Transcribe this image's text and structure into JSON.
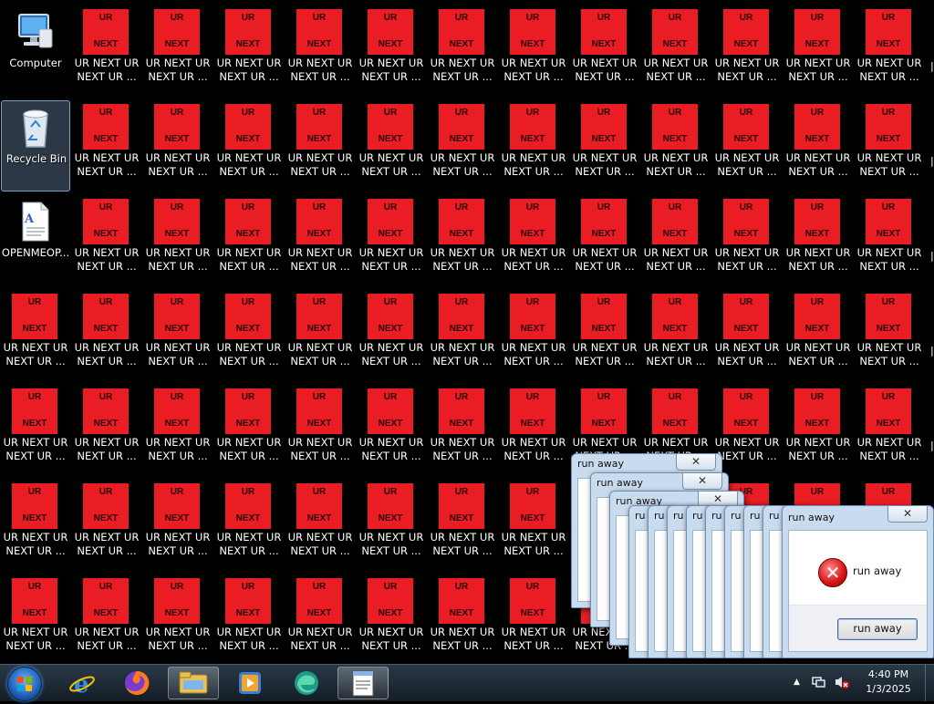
{
  "desktop": {
    "computer_label": "Computer",
    "recycle_label": "Recycle Bin",
    "doc_label": "OPENMEOP...",
    "ur_icon": {
      "top_text": "UR",
      "bottom_text": "NEXT",
      "line1": "UR NEXT UR",
      "line2": "NEXT UR ..."
    },
    "colors": {
      "ur_red": "#ea1c24"
    }
  },
  "dialog": {
    "title": "run away",
    "message": "run away",
    "button": "run away",
    "close_symbol": "✕",
    "cut_title": "ru"
  },
  "taskbar": {
    "time": "4:40 PM",
    "date": "1/3/2025",
    "apps": [
      "start-orb",
      "internet-explorer-icon",
      "firefox-icon",
      "file-explorer-icon",
      "media-player-icon",
      "edge-icon",
      "notepad-icon"
    ]
  }
}
